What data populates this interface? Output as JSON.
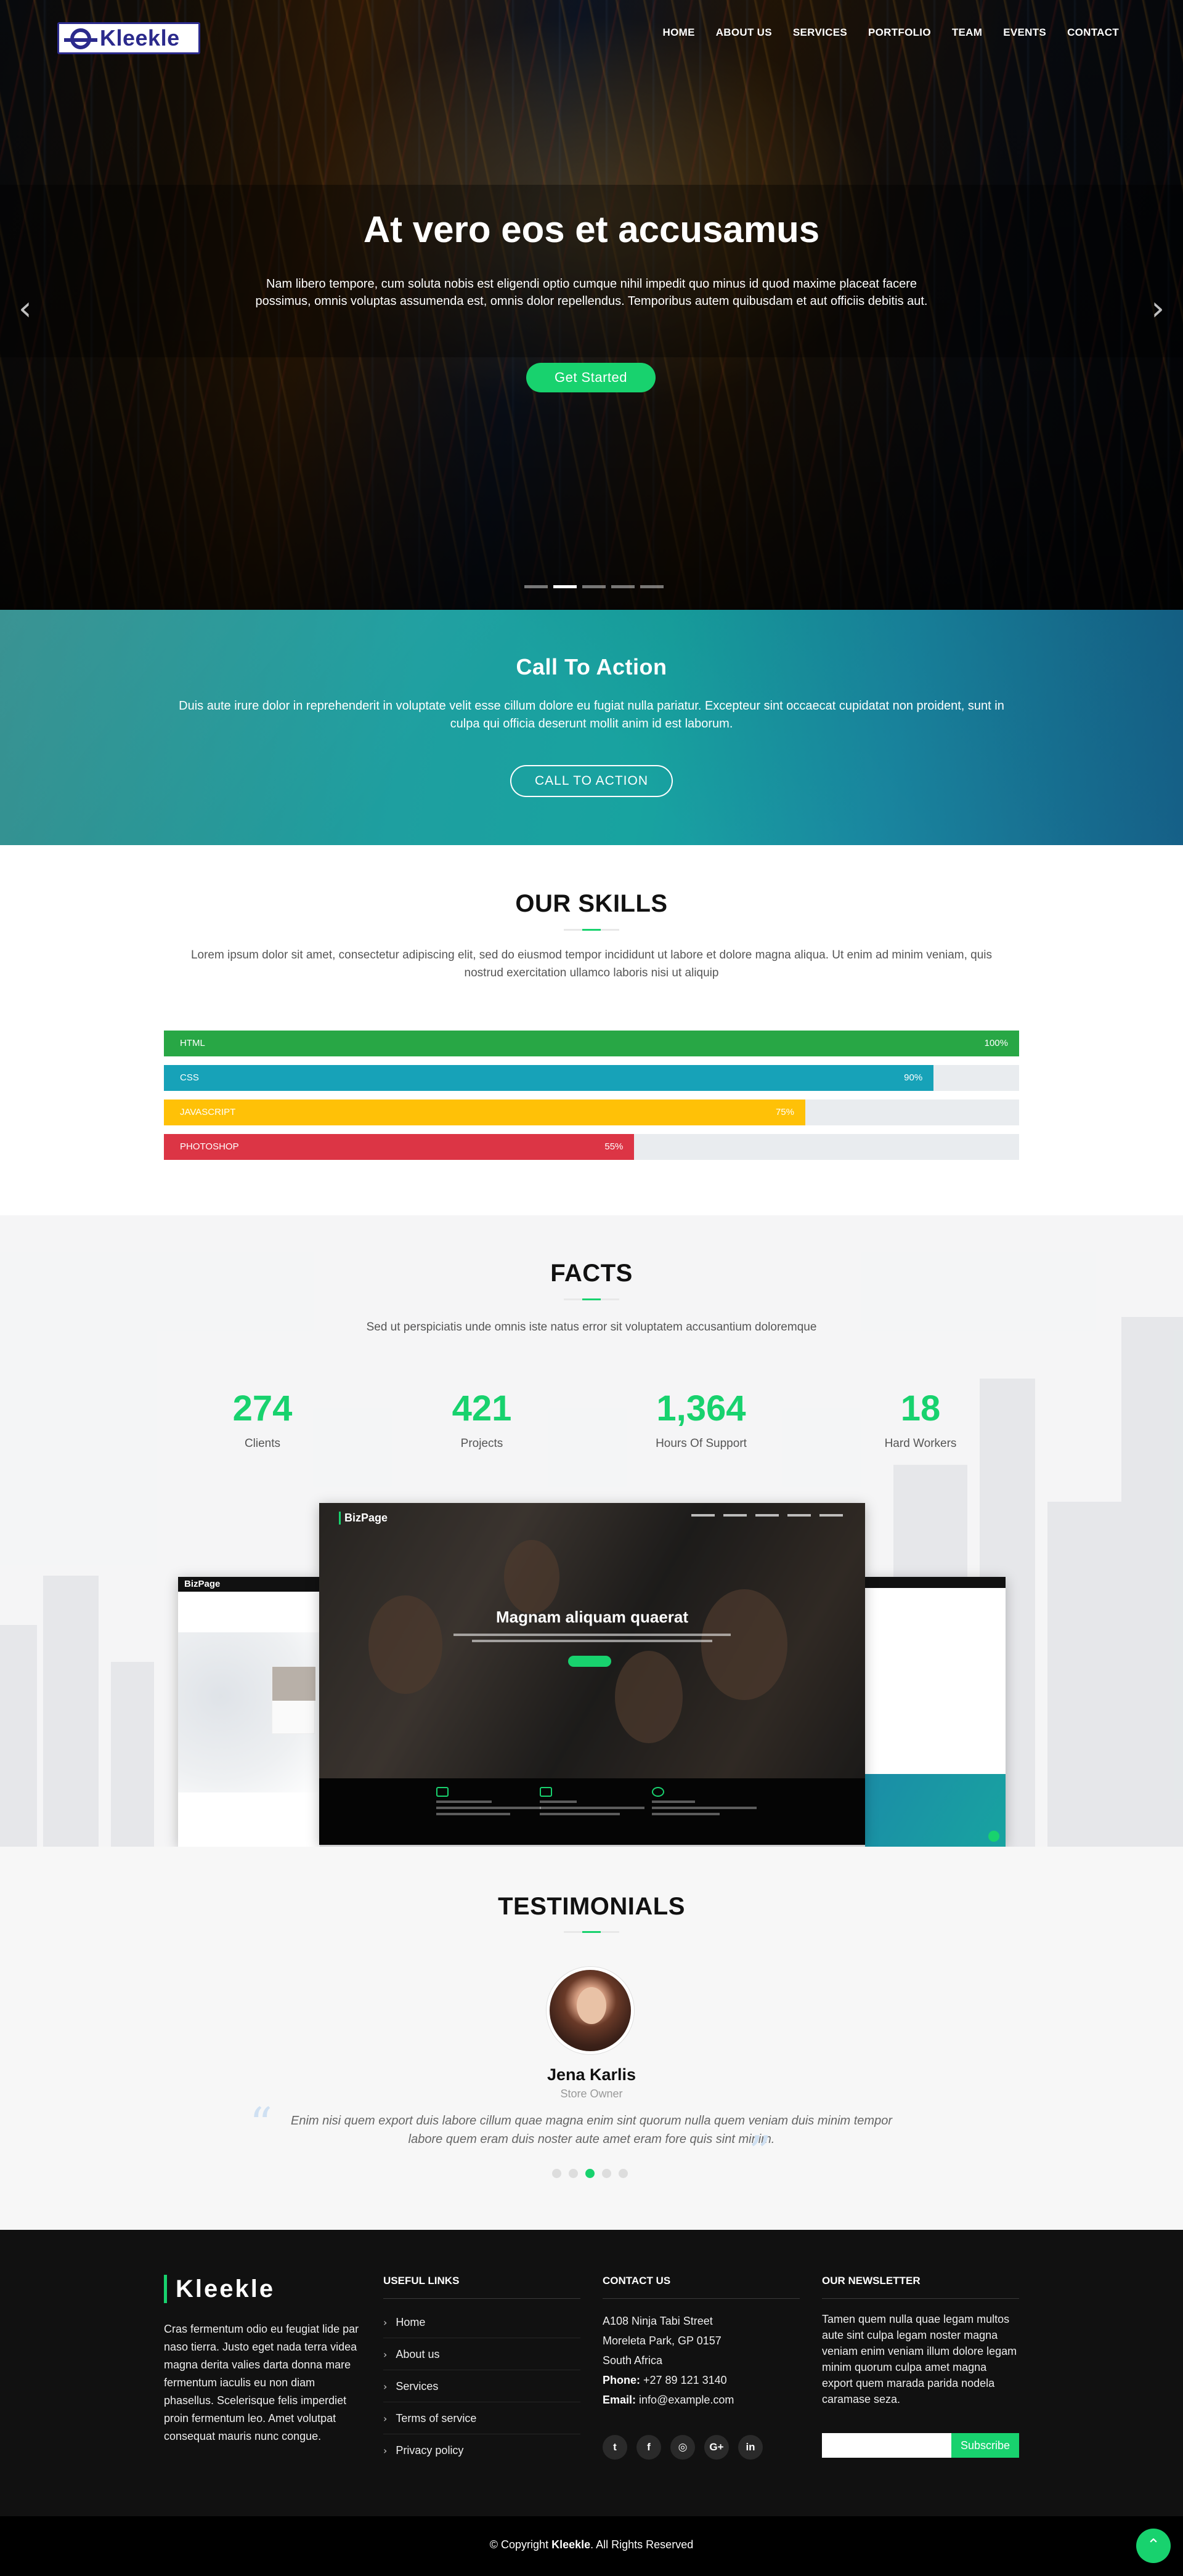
{
  "brand": {
    "name": "Kleekle"
  },
  "nav": {
    "items": [
      "HOME",
      "ABOUT US",
      "SERVICES",
      "PORTFOLIO",
      "TEAM",
      "EVENTS",
      "CONTACT"
    ]
  },
  "hero": {
    "title": "At vero eos et accusamus",
    "text": "Nam libero tempore, cum soluta nobis est eligendi optio cumque nihil impedit quo minus id quod maxime placeat facere possimus, omnis voluptas assumenda est, omnis dolor repellendus. Temporibus autem quibusdam et aut officiis debitis aut.",
    "button": "Get Started",
    "prev_icon": "chevron-left-icon",
    "next_icon": "chevron-right-icon",
    "slides": 5,
    "active_slide": 1
  },
  "cta": {
    "title": "Call To Action",
    "text": "Duis aute irure dolor in reprehenderit in voluptate velit esse cillum dolore eu fugiat nulla pariatur. Excepteur sint occaecat cupidatat non proident, sunt in culpa qui officia deserunt mollit anim id est laborum.",
    "button": "CALL TO ACTION"
  },
  "skills": {
    "title": "OUR SKILLS",
    "description": "Lorem ipsum dolor sit amet, consectetur adipiscing elit, sed do eiusmod tempor incididunt ut labore et dolore magna aliqua. Ut enim ad minim veniam, quis nostrud exercitation ullamco laboris nisi ut aliquip",
    "items": [
      {
        "name": "HTML",
        "percent": 100,
        "label": "100%",
        "color": "#28a745"
      },
      {
        "name": "CSS",
        "percent": 90,
        "label": "90%",
        "color": "#17a2b8"
      },
      {
        "name": "JAVASCRIPT",
        "percent": 75,
        "label": "75%",
        "color": "#ffc107"
      },
      {
        "name": "PHOTOSHOP",
        "percent": 55,
        "label": "55%",
        "color": "#dc3545"
      }
    ]
  },
  "facts": {
    "title": "FACTS",
    "description": "Sed ut perspiciatis unde omnis iste natus error sit voluptatem accusantium doloremque",
    "counters": [
      {
        "value": "274",
        "label": "Clients"
      },
      {
        "value": "421",
        "label": "Projects"
      },
      {
        "value": "1,364",
        "label": "Hours Of Support"
      },
      {
        "value": "18",
        "label": "Hard Workers"
      }
    ],
    "mockups": {
      "main_brand": "BizPage",
      "main_title": "Magnam aliquam quaerat",
      "left_brand": "BizPage"
    }
  },
  "testimonials": {
    "title": "TESTIMONIALS",
    "name": "Jena Karlis",
    "role": "Store Owner",
    "quote": "Enim nisi quem export duis labore cillum quae magna enim sint quorum nulla quem veniam duis minim tempor labore quem eram duis noster aute amet eram fore quis sint minim.",
    "dots": 5,
    "active_dot": 2
  },
  "footer": {
    "brand": "Kleekle",
    "about": "Cras fermentum odio eu feugiat lide par naso tierra. Justo eget nada terra videa magna derita valies darta donna mare fermentum iaculis eu non diam phasellus. Scelerisque felis imperdiet proin fermentum leo. Amet volutpat consequat mauris nunc congue.",
    "links_title": "USEFUL LINKS",
    "links": [
      "Home",
      "About us",
      "Services",
      "Terms of service",
      "Privacy policy"
    ],
    "contact_title": "CONTACT US",
    "address1": "A108 Ninja Tabi Street",
    "address2": "Moreleta Park, GP 0157",
    "address3": "South Africa",
    "phone_label": "Phone:",
    "phone": "+27 89 121 3140",
    "email_label": "Email:",
    "email": "info@example.com",
    "social_icons": [
      "twitter-icon",
      "facebook-icon",
      "instagram-icon",
      "google-plus-icon",
      "linkedin-icon"
    ],
    "newsletter_title": "OUR NEWSLETTER",
    "newsletter_text": "Tamen quem nulla quae legam multos aute sint culpa legam noster magna veniam enim veniam illum dolore legam minim quorum culpa amet magna export quem marada parida nodela caramase seza.",
    "subscribe": "Subscribe",
    "copyright_prefix": "© Copyright",
    "copyright_brand": "Kleekle",
    "copyright_suffix": ". All Rights Reserved",
    "back_to_top_icon": "chevron-up-icon"
  },
  "colors": {
    "accent": "#18d26e",
    "logo": "#2b2a8c",
    "footer_bg": "#111111"
  }
}
